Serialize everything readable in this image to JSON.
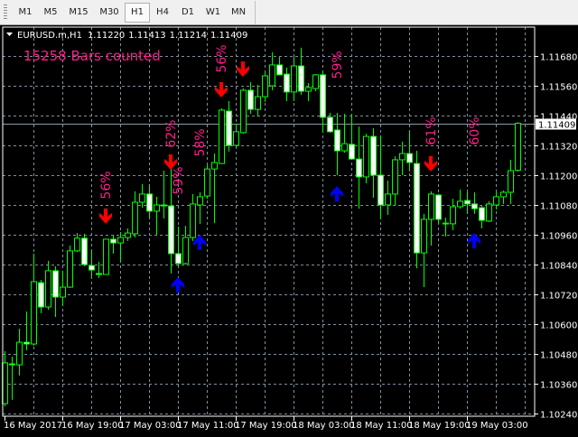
{
  "toolbar": {
    "timeframes": [
      "M1",
      "M5",
      "M15",
      "M30",
      "H1",
      "H4",
      "D1",
      "W1",
      "MN"
    ],
    "selected": "H1"
  },
  "header": {
    "symbol": "EURUSD.m,H1",
    "open": "1.11220",
    "high": "1.11413",
    "low": "1.11214",
    "close": "1.11409"
  },
  "indicator_text": "15258 Bars counted",
  "colors": {
    "bull": "#00ff00",
    "bear_fill": "#ffffff",
    "grid": "#7f8fa0",
    "down_arrow": "#ff0000",
    "up_arrow": "#0000ff",
    "pct_text": "#ff1e8c",
    "bid_line": "#8a9aa8"
  },
  "chart_data": {
    "type": "candlestick",
    "ylim": [
      1.1024,
      1.1168
    ],
    "price_ticks": [
      "1.11680",
      "1.11560",
      "1.11440",
      "1.11320",
      "1.11200",
      "1.11080",
      "1.10960",
      "1.10840",
      "1.10720",
      "1.10600",
      "1.10480",
      "1.10360",
      "1.10240"
    ],
    "time_labels": [
      "16 May 2017",
      "16 May 19:00",
      "17 May 03:00",
      "17 May 11:00",
      "17 May 19:00",
      "18 May 03:00",
      "18 May 11:00",
      "18 May 19:00",
      "19 May 03:00"
    ],
    "bid": "1.11409",
    "candles": [
      [
        1.1028,
        1.10491,
        1.10269,
        1.10444
      ],
      [
        1.1044,
        1.10469,
        1.10295,
        1.10436
      ],
      [
        1.10436,
        1.10582,
        1.10393,
        1.10527
      ],
      [
        1.10527,
        1.10651,
        1.10495,
        1.1052
      ],
      [
        1.1052,
        1.10884,
        1.10513,
        1.10771
      ],
      [
        1.10767,
        1.10778,
        1.10644,
        1.10669
      ],
      [
        1.10669,
        1.10855,
        1.10658,
        1.10815
      ],
      [
        1.10815,
        1.10833,
        1.10629,
        1.10709
      ],
      [
        1.10709,
        1.10815,
        1.10673,
        1.10749
      ],
      [
        1.10749,
        1.10916,
        1.10746,
        1.10895
      ],
      [
        1.10895,
        1.10967,
        1.10891,
        1.10946
      ],
      [
        1.10946,
        1.10964,
        1.10833,
        1.1084
      ],
      [
        1.10836,
        1.10898,
        1.10786,
        1.10818
      ],
      [
        1.10804,
        1.10851,
        1.10786,
        1.108
      ],
      [
        1.108,
        1.10942,
        1.108,
        1.10942
      ],
      [
        1.10942,
        1.1096,
        1.10884,
        1.10927
      ],
      [
        1.10927,
        1.10971,
        1.10851,
        1.10949
      ],
      [
        1.10949,
        1.10986,
        1.10935,
        1.10967
      ],
      [
        1.10964,
        1.11135,
        1.10949,
        1.11091
      ],
      [
        1.11091,
        1.11164,
        1.11069,
        1.11124
      ],
      [
        1.11124,
        1.11164,
        1.11026,
        1.11055
      ],
      [
        1.11055,
        1.11113,
        1.1096,
        1.1108
      ],
      [
        1.1108,
        1.11218,
        1.11026,
        1.11076
      ],
      [
        1.11076,
        1.1124,
        1.10804,
        1.10884
      ],
      [
        1.10884,
        1.10993,
        1.10833,
        1.10844
      ],
      [
        1.10844,
        1.10996,
        1.1084,
        1.10949
      ],
      [
        1.10949,
        1.11124,
        1.10935,
        1.11084
      ],
      [
        1.1108,
        1.11131,
        1.11004,
        1.11113
      ],
      [
        1.11116,
        1.1124,
        1.11105,
        1.11225
      ],
      [
        1.11225,
        1.11287,
        1.11007,
        1.11251
      ],
      [
        1.11247,
        1.11469,
        1.11244,
        1.11462
      ],
      [
        1.11458,
        1.11498,
        1.11295,
        1.1132
      ],
      [
        1.1132,
        1.11407,
        1.11313,
        1.11375
      ],
      [
        1.11371,
        1.11549,
        1.11367,
        1.11542
      ],
      [
        1.11542,
        1.11575,
        1.11447,
        1.11465
      ],
      [
        1.11465,
        1.11564,
        1.11436,
        1.11516
      ],
      [
        1.11516,
        1.11615,
        1.11495,
        1.116
      ],
      [
        1.1156,
        1.11695,
        1.11542,
        1.11644
      ],
      [
        1.11644,
        1.11676,
        1.11604,
        1.11604
      ],
      [
        1.11607,
        1.11633,
        1.11498,
        1.11535
      ],
      [
        1.11535,
        1.11676,
        1.11498,
        1.1164
      ],
      [
        1.1164,
        1.11713,
        1.11524,
        1.11538
      ],
      [
        1.11538,
        1.11571,
        1.11498,
        1.11553
      ],
      [
        1.11549,
        1.11607,
        1.11538,
        1.11604
      ],
      [
        1.11604,
        1.11622,
        1.11371,
        1.11433
      ],
      [
        1.11433,
        1.11451,
        1.11371,
        1.11375
      ],
      [
        1.11382,
        1.11451,
        1.112,
        1.11298
      ],
      [
        1.11298,
        1.11447,
        1.11291,
        1.11327
      ],
      [
        1.11324,
        1.11447,
        1.11262,
        1.11265
      ],
      [
        1.11265,
        1.11396,
        1.11065,
        1.11193
      ],
      [
        1.11193,
        1.11367,
        1.11167,
        1.11356
      ],
      [
        1.11356,
        1.11389,
        1.11109,
        1.112
      ],
      [
        1.112,
        1.1136,
        1.11022,
        1.1108
      ],
      [
        1.1108,
        1.11178,
        1.1104,
        1.11124
      ],
      [
        1.11124,
        1.11276,
        1.11076,
        1.11262
      ],
      [
        1.11262,
        1.11335,
        1.112,
        1.11287
      ],
      [
        1.11287,
        1.11378,
        1.11215,
        1.11251
      ],
      [
        1.11247,
        1.11298,
        1.10825,
        1.10887
      ],
      [
        1.10887,
        1.11044,
        1.10749,
        1.11022
      ],
      [
        1.11022,
        1.11135,
        1.10916,
        1.11124
      ],
      [
        1.1112,
        1.11124,
        1.11004,
        1.11022
      ],
      [
        1.11007,
        1.11029,
        1.10953,
        1.11004
      ],
      [
        1.11004,
        1.11105,
        1.10978,
        1.11073
      ],
      [
        1.11073,
        1.11142,
        1.11065,
        1.11095
      ],
      [
        1.11098,
        1.11131,
        1.11044,
        1.11084
      ],
      [
        1.11084,
        1.11131,
        1.11044,
        1.11065
      ],
      [
        1.11069,
        1.11076,
        1.10986,
        1.11018
      ],
      [
        1.11015,
        1.11095,
        1.11011,
        1.11084
      ],
      [
        1.1108,
        1.11131,
        1.11062,
        1.11113
      ],
      [
        1.11113,
        1.11138,
        1.11084,
        1.11131
      ],
      [
        1.11131,
        1.11262,
        1.11084,
        1.11218
      ],
      [
        1.1122,
        1.11413,
        1.11214,
        1.11409
      ]
    ],
    "signals": [
      {
        "bar": 14,
        "dir": "down",
        "arrow_price": 1.11033,
        "pct": "56%",
        "label_price": 1.1116
      },
      {
        "bar": 23,
        "dir": "down",
        "arrow_price": 1.11251,
        "pct": "62%",
        "label_price": 1.11367
      },
      {
        "bar": 24,
        "dir": "up",
        "arrow_price": 1.1076,
        "pct": "59%",
        "label_price": 1.11178
      },
      {
        "bar": 27,
        "dir": "up",
        "arrow_price": 1.10931,
        "pct": "58%",
        "label_price": 1.11331
      },
      {
        "bar": 30,
        "dir": "down",
        "arrow_price": 1.11542,
        "pct": "56%",
        "label_price": 1.11669
      },
      {
        "bar": 33,
        "dir": "down",
        "arrow_price": 1.11625
      },
      {
        "bar": 46,
        "dir": "up",
        "arrow_price": 1.11127,
        "pct": "59%",
        "label_price": 1.11644
      },
      {
        "bar": 59,
        "dir": "down",
        "arrow_price": 1.11244,
        "pct": "61%",
        "label_price": 1.11378
      },
      {
        "bar": 65,
        "dir": "up",
        "arrow_price": 1.10938,
        "pct": "60%",
        "label_price": 1.11378
      }
    ]
  }
}
